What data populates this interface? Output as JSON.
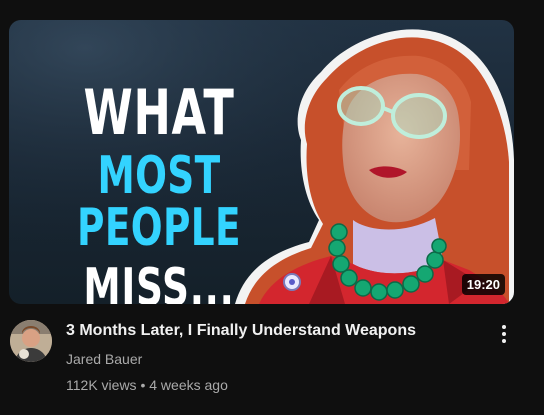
{
  "video": {
    "title": "3 Months Later, I Finally Understand Weapons",
    "channel": "Jared Bauer",
    "views": "112K views",
    "separator": "•",
    "age": "4 weeks ago",
    "duration": "19:20"
  },
  "thumbnail": {
    "line1": "WHAT",
    "line2": "MOST PEOPLE",
    "line3": "MISS..."
  },
  "icons": {
    "more": "more-vert-icon"
  },
  "colors": {
    "background": "#0f0f0f",
    "title": "#f1f1f1",
    "meta": "#aaaaaa",
    "accent_text": "#33d3ff"
  }
}
